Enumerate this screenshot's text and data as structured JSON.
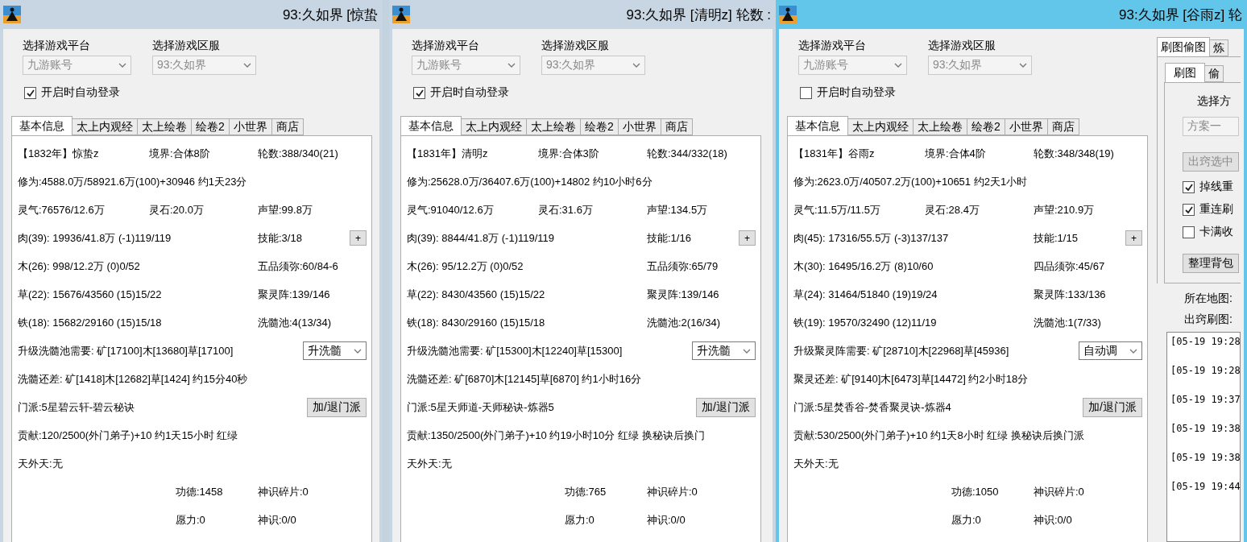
{
  "windows": [
    {
      "title": "93:久如界 [惊蛰",
      "active": false,
      "platform": {
        "label": "选择游戏平台",
        "value": "九游账号",
        "disabled": true
      },
      "server": {
        "label": "选择游戏区服",
        "value": "93:久如界",
        "disabled": true
      },
      "auto_login": {
        "label": "开启时自动登录",
        "checked": true
      },
      "tabs": [
        {
          "label": "基本信息",
          "selected": true
        },
        {
          "label": "太上内观经",
          "selected": false
        },
        {
          "label": "太上绘卷",
          "selected": false
        },
        {
          "label": "绘卷2",
          "selected": false
        },
        {
          "label": "小世界",
          "selected": false
        },
        {
          "label": "商店",
          "selected": false
        }
      ],
      "rows": [
        {
          "kind": "triple",
          "cells": [
            "【1832年】惊蛰z",
            "境界:合体8阶",
            "轮数:388/340(21)"
          ]
        },
        {
          "kind": "line",
          "cells": [
            "修为:4588.0万/58921.6万(100)+30946 约1天23分"
          ]
        },
        {
          "kind": "triple",
          "cells": [
            "灵气:76576/12.6万",
            "灵石:20.0万",
            "声望:99.8万"
          ]
        },
        {
          "kind": "pair",
          "cells": [
            "肉(39): 19936/41.8万 (-1)119/119",
            "技能:3/18"
          ],
          "button": "+"
        },
        {
          "kind": "pair",
          "cells": [
            "木(26): 998/12.2万 (0)0/52",
            "五品须弥:60/84-6"
          ]
        },
        {
          "kind": "pair",
          "cells": [
            "草(22): 15676/43560 (15)15/22",
            "聚灵阵:139/146"
          ]
        },
        {
          "kind": "pair",
          "cells": [
            "铁(18): 15682/29160 (15)15/18",
            "洗髓池:4(13/34)"
          ]
        },
        {
          "kind": "line",
          "cells": [
            "升级洗髓池需要: 矿[17100]木[13680]草[17100]"
          ],
          "select": "升洗髓"
        },
        {
          "kind": "line",
          "cells": [
            "洗髓还差: 矿[1418]木[12682]草[1424] 约15分40秒"
          ]
        },
        {
          "kind": "line",
          "cells": [
            "门派:5星碧云轩-碧云秘诀"
          ],
          "button": "加/退门派"
        },
        {
          "kind": "line",
          "cells": [
            "贡献:120/2500(外门弟子)+10 约1天15小时 红绿"
          ]
        },
        {
          "kind": "line",
          "cells": [
            "天外天:无"
          ]
        },
        {
          "kind": "indented",
          "cells": [
            "功德:1458",
            "神识碎片:0"
          ]
        },
        {
          "kind": "indented",
          "cells": [
            "愿力:0",
            "神识:0/0"
          ]
        }
      ]
    },
    {
      "title": "93:久如界 [清明z] 轮数 :",
      "active": false,
      "platform": {
        "label": "选择游戏平台",
        "value": "九游账号",
        "disabled": true
      },
      "server": {
        "label": "选择游戏区服",
        "value": "93:久如界",
        "disabled": true
      },
      "auto_login": {
        "label": "开启时自动登录",
        "checked": true
      },
      "tabs": [
        {
          "label": "基本信息",
          "selected": true
        },
        {
          "label": "太上内观经",
          "selected": false
        },
        {
          "label": "太上绘卷",
          "selected": false
        },
        {
          "label": "绘卷2",
          "selected": false
        },
        {
          "label": "小世界",
          "selected": false
        },
        {
          "label": "商店",
          "selected": false
        }
      ],
      "rows": [
        {
          "kind": "triple",
          "cells": [
            "【1831年】清明z",
            "境界:合体3阶",
            "轮数:344/332(18)"
          ]
        },
        {
          "kind": "line",
          "cells": [
            "修为:25628.0万/36407.6万(100)+14802 约10小时6分"
          ]
        },
        {
          "kind": "triple",
          "cells": [
            "灵气:91040/12.6万",
            "灵石:31.6万",
            "声望:134.5万"
          ]
        },
        {
          "kind": "pair",
          "cells": [
            "肉(39): 8844/41.8万 (-1)119/119",
            "技能:1/16"
          ],
          "button": "+"
        },
        {
          "kind": "pair",
          "cells": [
            "木(26): 95/12.2万 (0)0/52",
            "五品须弥:65/79"
          ]
        },
        {
          "kind": "pair",
          "cells": [
            "草(22): 8430/43560 (15)15/22",
            "聚灵阵:139/146"
          ]
        },
        {
          "kind": "pair",
          "cells": [
            "铁(18): 8430/29160 (15)15/18",
            "洗髓池:2(16/34)"
          ]
        },
        {
          "kind": "line",
          "cells": [
            "升级洗髓池需要: 矿[15300]木[12240]草[15300]"
          ],
          "select": "升洗髓"
        },
        {
          "kind": "line",
          "cells": [
            "洗髓还差: 矿[6870]木[12145]草[6870] 约1小时16分"
          ]
        },
        {
          "kind": "line",
          "cells": [
            "门派:5星天师道-天师秘诀-炼器5"
          ],
          "button": "加/退门派"
        },
        {
          "kind": "line",
          "cells": [
            "贡献:1350/2500(外门弟子)+10 约19小时10分 红绿 换秘诀后换门"
          ]
        },
        {
          "kind": "line",
          "cells": [
            "天外天:无"
          ]
        },
        {
          "kind": "indented",
          "cells": [
            "功德:765",
            "神识碎片:0"
          ]
        },
        {
          "kind": "indented",
          "cells": [
            "愿力:0",
            "神识:0/0"
          ]
        }
      ]
    },
    {
      "title": "93:久如界 [谷雨z] 轮",
      "active": true,
      "platform": {
        "label": "选择游戏平台",
        "value": "九游账号",
        "disabled": true
      },
      "server": {
        "label": "选择游戏区服",
        "value": "93:久如界",
        "disabled": true
      },
      "auto_login": {
        "label": "开启时自动登录",
        "checked": false
      },
      "tabs": [
        {
          "label": "基本信息",
          "selected": true
        },
        {
          "label": "太上内观经",
          "selected": false
        },
        {
          "label": "太上绘卷",
          "selected": false
        },
        {
          "label": "绘卷2",
          "selected": false
        },
        {
          "label": "小世界",
          "selected": false
        },
        {
          "label": "商店",
          "selected": false
        }
      ],
      "rows": [
        {
          "kind": "triple",
          "cells": [
            "【1831年】谷雨z",
            "境界:合体4阶",
            "轮数:348/348(19)"
          ]
        },
        {
          "kind": "line",
          "cells": [
            "修为:2623.0万/40507.2万(100)+10651 约2天1小时"
          ]
        },
        {
          "kind": "triple",
          "cells": [
            "灵气:11.5万/11.5万",
            "灵石:28.4万",
            "声望:210.9万"
          ]
        },
        {
          "kind": "pair",
          "cells": [
            "肉(45): 17316/55.5万 (-3)137/137",
            "技能:1/15"
          ],
          "button": "+"
        },
        {
          "kind": "pair",
          "cells": [
            "木(30): 16495/16.2万 (8)10/60",
            "四品须弥:45/67"
          ]
        },
        {
          "kind": "pair",
          "cells": [
            "草(24): 31464/51840 (19)19/24",
            "聚灵阵:133/136"
          ]
        },
        {
          "kind": "pair",
          "cells": [
            "铁(19): 19570/32490 (12)11/19",
            "洗髓池:1(7/33)"
          ]
        },
        {
          "kind": "line",
          "cells": [
            "升级聚灵阵需要: 矿[28710]木[22968]草[45936]"
          ],
          "select": "自动调"
        },
        {
          "kind": "line",
          "cells": [
            "聚灵还差: 矿[9140]木[6473]草[14472] 约2小时18分"
          ]
        },
        {
          "kind": "line",
          "cells": [
            "门派:5星焚香谷-焚香聚灵诀-炼器4"
          ],
          "button": "加/退门派"
        },
        {
          "kind": "line",
          "cells": [
            "贡献:530/2500(外门弟子)+10 约1天8小时 红绿 换秘诀后换门派"
          ]
        },
        {
          "kind": "line",
          "cells": [
            "天外天:无"
          ]
        },
        {
          "kind": "indented",
          "cells": [
            "功德:1050",
            "神识碎片:0"
          ]
        },
        {
          "kind": "indented",
          "cells": [
            "愿力:0",
            "神识:0/0"
          ]
        }
      ],
      "side": {
        "tabs": [
          {
            "label": "刷图偷图",
            "selected": true
          },
          {
            "label": "炼",
            "selected": false
          }
        ],
        "subtabs": [
          {
            "label": "刷图",
            "selected": true
          },
          {
            "label": "偷",
            "selected": false
          }
        ],
        "scheme_label": "选择方",
        "scheme": {
          "value": "方案一",
          "disabled": true
        },
        "action": {
          "label": "出窍选中",
          "disabled": true
        },
        "options": [
          {
            "label": "掉线重",
            "checked": true
          },
          {
            "label": "重连刷",
            "checked": true
          },
          {
            "label": "卡满收",
            "checked": false
          }
        ],
        "tidy_button": "整理背包",
        "map_label": "所在地图:",
        "route_label": "出窍刷图:",
        "log": [
          "[05-19 19:28",
          "[05-19 19:28",
          "[05-19 19:37",
          "[05-19 19:38",
          "[05-19 19:38",
          "[05-19 19:44"
        ]
      }
    }
  ]
}
